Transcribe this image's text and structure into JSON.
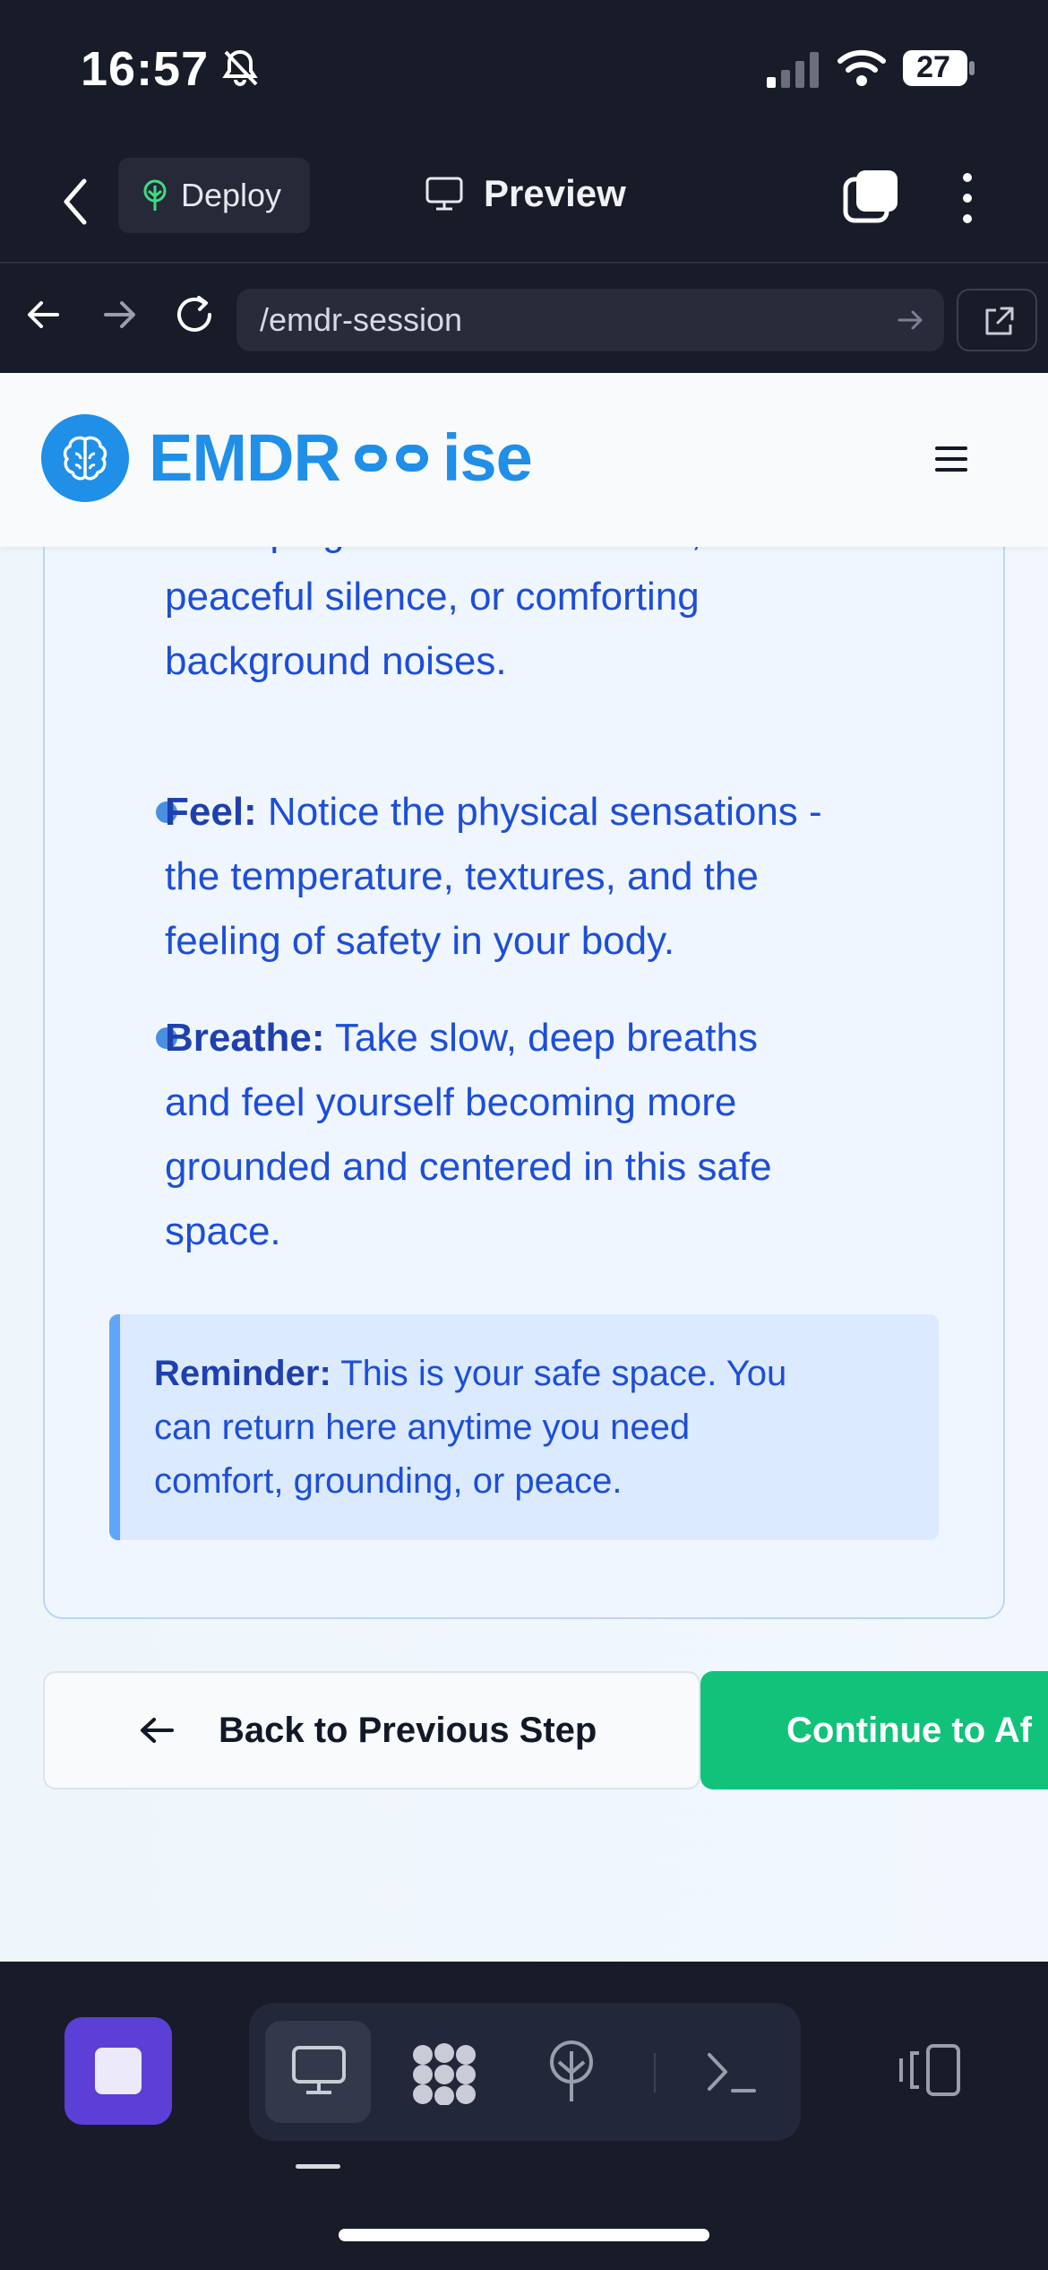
{
  "status_bar": {
    "time": "16:57",
    "battery": "27"
  },
  "app_bar": {
    "deploy_label": "Deploy",
    "preview_label": "Preview"
  },
  "browser": {
    "url": "/emdr-session"
  },
  "site": {
    "logo_prefix": "EMDR",
    "logo_suffix": "ise",
    "brand_color": "#1f8fe8"
  },
  "card": {
    "hear_continuation_lines": [
      "Perhaps gentle nature sounds,",
      "peaceful silence, or comforting",
      "background noises."
    ],
    "feel_label": "Feel:",
    "feel_text_lines": [
      " Notice the physical sensations -",
      "the temperature, textures, and the",
      "feeling of safety in your body."
    ],
    "breathe_label": "Breathe:",
    "breathe_text_lines": [
      " Take slow, deep breaths",
      "and feel yourself becoming more",
      "grounded and centered in this safe",
      "space."
    ],
    "reminder_label": "Reminder:",
    "reminder_text_lines": [
      " This is your safe space. You",
      "can return here anytime you need",
      "comfort, grounding, or peace."
    ]
  },
  "actions": {
    "back_label": "Back to Previous Step",
    "continue_label": "Continue to Af"
  },
  "colors": {
    "accent_green": "#10c27a",
    "stop_purple": "#5b3fd6",
    "text_blue": "#1d4ed8"
  }
}
